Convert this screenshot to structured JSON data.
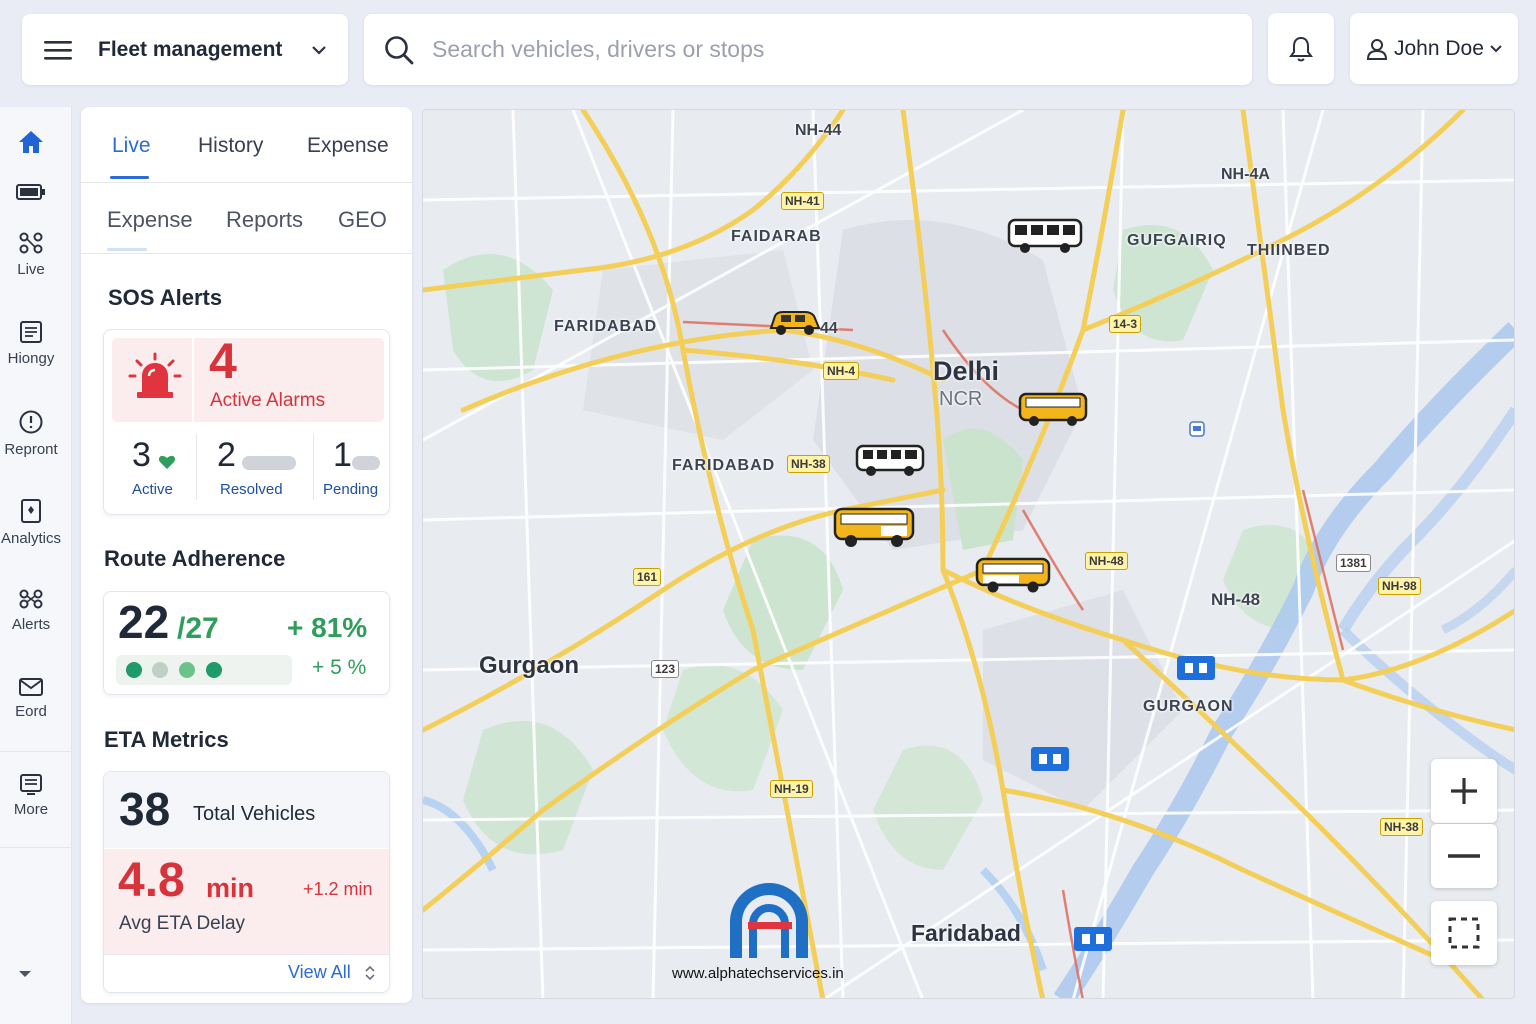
{
  "topbar": {
    "app_title": "Fleet management",
    "menu_icon": "hamburger-menu-icon"
  },
  "search": {
    "placeholder": "Search vehicles, drivers or stops"
  },
  "user": {
    "name": "John Doe"
  },
  "rail": {
    "items": [
      {
        "icon": "home-icon",
        "label": ""
      },
      {
        "icon": "battery-icon",
        "label": ""
      },
      {
        "icon": "live-icon",
        "label": "Live"
      },
      {
        "icon": "history-icon",
        "label": "Hiongy"
      },
      {
        "icon": "report-icon",
        "label": "Repront"
      },
      {
        "icon": "analytics-icon",
        "label": "Analytics"
      },
      {
        "icon": "alerts-icon",
        "label": "Alerts"
      },
      {
        "icon": "mail-icon",
        "label": "Eord"
      },
      {
        "icon": "more-icon",
        "label": "More"
      }
    ]
  },
  "panel": {
    "tabs": [
      "Live",
      "History",
      "Expense"
    ],
    "subtabs": [
      "Expense",
      "Reports",
      "GEO"
    ],
    "sos": {
      "title": "SOS Alerts",
      "count": "4",
      "count_label": "Active Alarms",
      "stats": [
        {
          "value": "3",
          "label": "Active"
        },
        {
          "value": "2",
          "label": "Resolved"
        },
        {
          "value": "1",
          "label": "Pending"
        }
      ]
    },
    "route": {
      "title": "Route Adherence",
      "value": "22",
      "total": "/27",
      "percent": "+ 81%",
      "delta": "+ 5 %"
    },
    "eta": {
      "title": "ETA Metrics",
      "total_value": "38",
      "total_label": "Total Vehicles",
      "delay_value": "4.8",
      "delay_unit": "min",
      "delay_change": "+1.2 min",
      "delay_label": "Avg ETA Delay",
      "view_all": "View All"
    }
  },
  "map": {
    "labels": {
      "delhi": "Delhi",
      "ncr": "NCR",
      "gurgaon": "Gurgaon",
      "faridabad_bottom": "Faridabad",
      "faridabad_1": "FARIDABAD",
      "faridabad_2": "FARIDABAD",
      "faidarab": "FAIDARAB",
      "gufgairiq": "GUFGAIRIQ",
      "thiinbed": "THIINBED",
      "gurgaon_caps": "GURGAON",
      "nh44_top": "NH-44",
      "nh4a": "NH-4A",
      "nh48": "NH-48",
      "a44": "44"
    },
    "shields": {
      "s1": "NH-41",
      "s2": "NH-4",
      "s3": "NH-38",
      "s4": "14-3",
      "s5": "161",
      "s6": "NH-48",
      "s7": "1381",
      "s8": "NH-98",
      "s9": "NH-19",
      "s10": "NH-38",
      "s11": "123"
    },
    "watermark": "www.alphatechservices.in",
    "controls": {
      "zoom_in": "zoom-in",
      "zoom_out": "zoom-out",
      "fullscreen": "fullscreen"
    },
    "colors": {
      "primary": "#2a6bd6",
      "alert": "#d8333b",
      "success": "#2e9e5a",
      "bus_yellow": "#f2b61c"
    }
  }
}
